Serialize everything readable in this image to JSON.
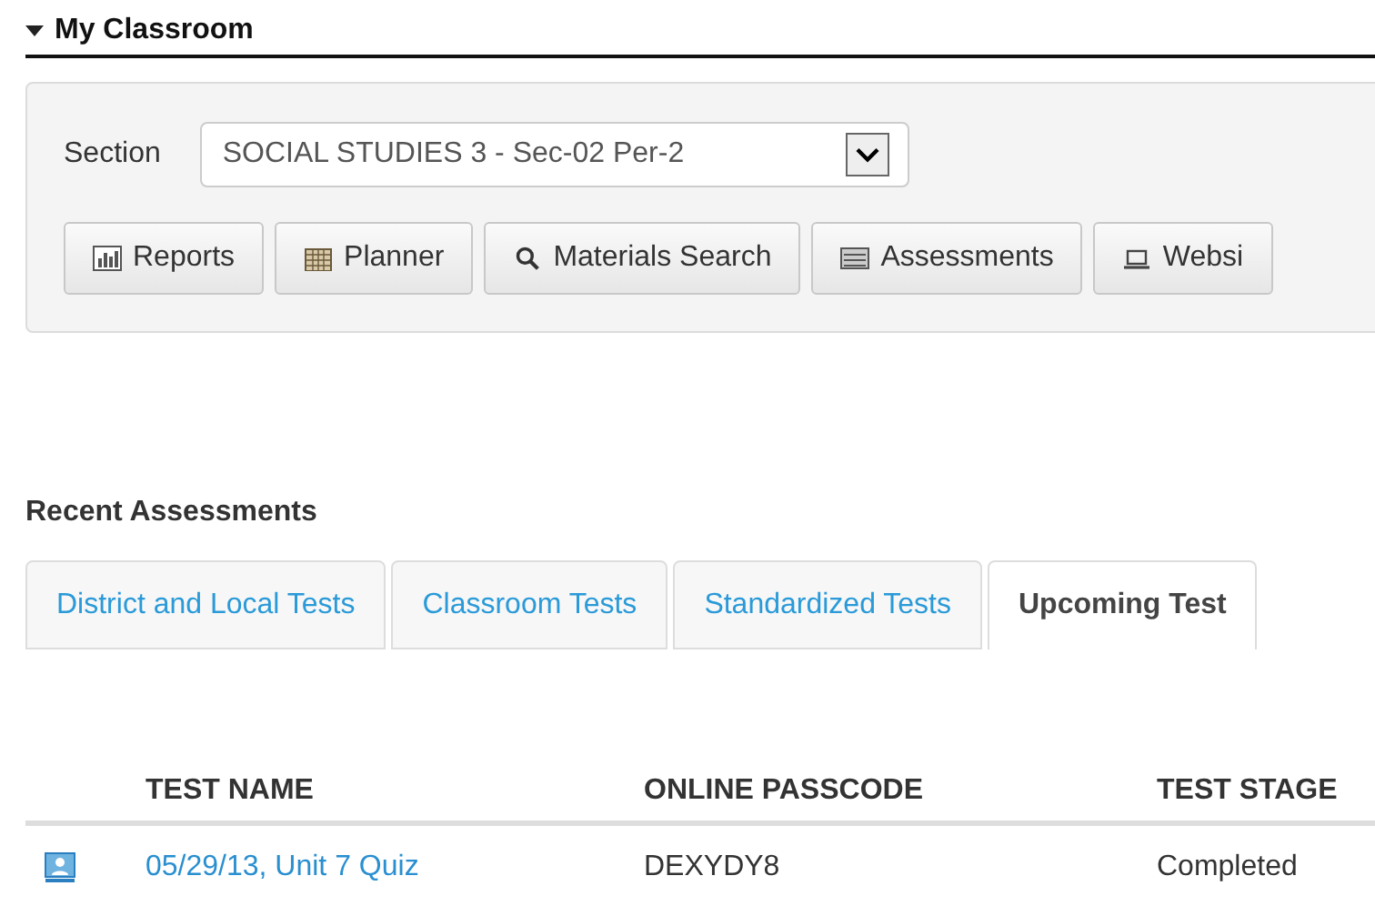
{
  "header": {
    "title": "My Classroom",
    "expanded": true
  },
  "section": {
    "label": "Section",
    "value": "SOCIAL STUDIES 3 - Sec-02 Per-2"
  },
  "toolbar": [
    {
      "label": "Reports",
      "kind": "chart"
    },
    {
      "label": "Planner",
      "kind": "calendar"
    },
    {
      "label": "Materials Search",
      "kind": "search"
    },
    {
      "label": "Assessments",
      "kind": "list"
    },
    {
      "label": "Websi",
      "kind": "laptop"
    }
  ],
  "recent": {
    "title": "Recent Assessments",
    "tabs": [
      {
        "label": "District and Local Tests",
        "selected": false
      },
      {
        "label": "Classroom Tests",
        "selected": false
      },
      {
        "label": "Standardized Tests",
        "selected": false
      },
      {
        "label": "Upcoming Test",
        "selected": true
      }
    ],
    "table": {
      "columns": [
        "TEST NAME",
        "ONLINE PASSCODE",
        "TEST STAGE"
      ],
      "rows": [
        {
          "name": "05/29/13, Unit 7 Quiz",
          "passcode": "DEXYDY8",
          "stage": "Completed"
        }
      ]
    }
  }
}
